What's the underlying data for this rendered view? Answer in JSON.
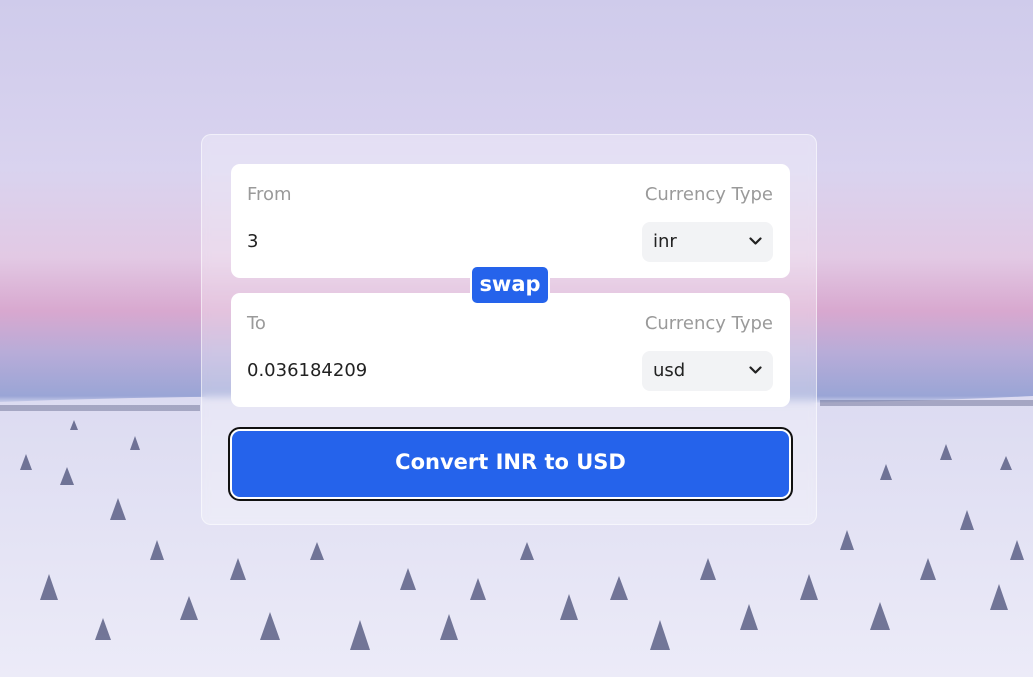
{
  "converter": {
    "from": {
      "label": "From",
      "type_label": "Currency Type",
      "amount": "3",
      "currency": "inr"
    },
    "to": {
      "label": "To",
      "type_label": "Currency Type",
      "amount": "0.036184209",
      "currency": "usd"
    },
    "swap_label": "swap",
    "convert_label": "Convert INR to USD"
  },
  "colors": {
    "accent": "#2563eb",
    "panel": "#ffffff",
    "select_bg": "#f2f3f5"
  },
  "background": {
    "scene": "snowy-forest-landscape-with-pink-purple-sky"
  }
}
